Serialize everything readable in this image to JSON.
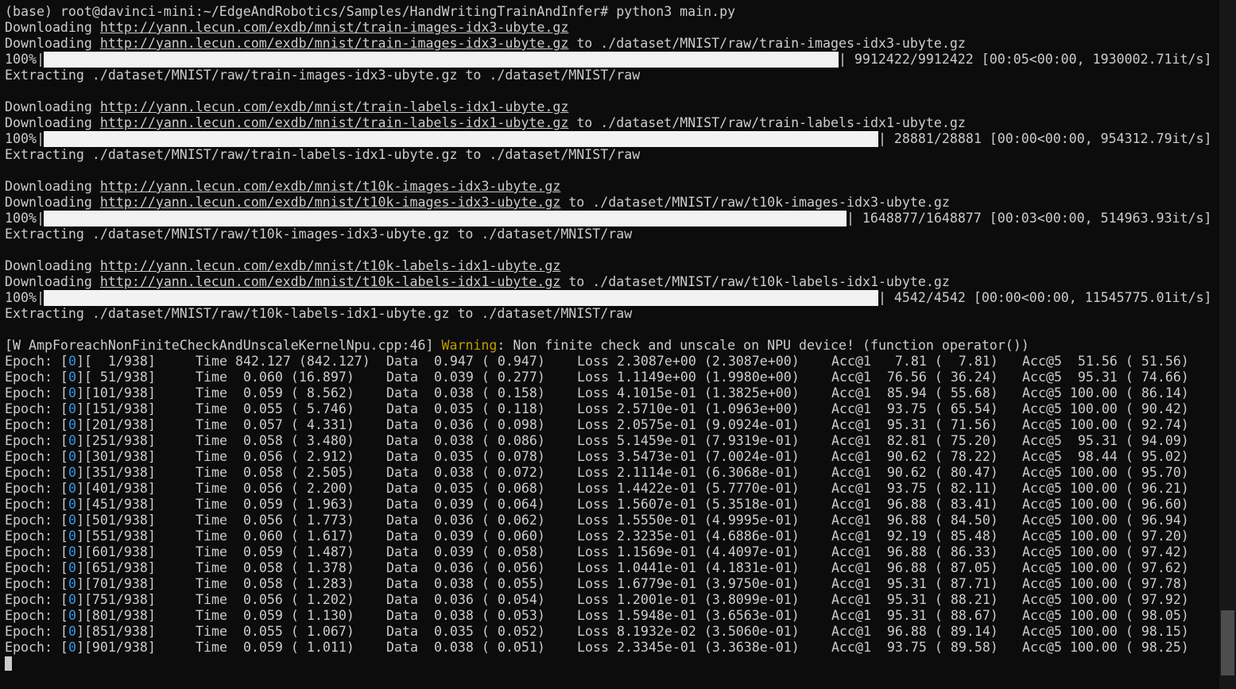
{
  "terminal": {
    "prompt": "(base) root@davinci-mini:~/EdgeAndRobotics/Samples/HandWritingTrainAndInfer# python3 main.py",
    "downloads": [
      {
        "url": "http://yann.lecun.com/exdb/mnist/train-images-idx3-ubyte.gz",
        "dest": "./dataset/MNIST/raw/train-images-idx3-ubyte.gz",
        "progress_pct": "100%|",
        "progress_fraction": 1.0,
        "progress_stats": "| 9912422/9912422 [00:05<00:00, 1930002.71it/s]",
        "extract": "Extracting ./dataset/MNIST/raw/train-images-idx3-ubyte.gz to ./dataset/MNIST/raw"
      },
      {
        "url": "http://yann.lecun.com/exdb/mnist/train-labels-idx1-ubyte.gz",
        "dest": "./dataset/MNIST/raw/train-labels-idx1-ubyte.gz",
        "progress_pct": "100%|",
        "progress_fraction": 1.0,
        "progress_stats": "| 28881/28881 [00:00<00:00, 954312.79it/s]",
        "extract": "Extracting ./dataset/MNIST/raw/train-labels-idx1-ubyte.gz to ./dataset/MNIST/raw"
      },
      {
        "url": "http://yann.lecun.com/exdb/mnist/t10k-images-idx3-ubyte.gz",
        "dest": "./dataset/MNIST/raw/t10k-images-idx3-ubyte.gz",
        "progress_pct": "100%|",
        "progress_fraction": 1.0,
        "progress_stats": "| 1648877/1648877 [00:03<00:00, 514963.93it/s]",
        "extract": "Extracting ./dataset/MNIST/raw/t10k-images-idx3-ubyte.gz to ./dataset/MNIST/raw"
      },
      {
        "url": "http://yann.lecun.com/exdb/mnist/t10k-labels-idx1-ubyte.gz",
        "dest": "./dataset/MNIST/raw/t10k-labels-idx1-ubyte.gz",
        "progress_pct": "100%|",
        "progress_fraction": 1.0,
        "progress_stats": "| 4542/4542 [00:00<00:00, 11545775.01it/s]",
        "extract": "Extracting ./dataset/MNIST/raw/t10k-labels-idx1-ubyte.gz to ./dataset/MNIST/raw"
      }
    ],
    "words": {
      "downloading": "Downloading ",
      "to": " to "
    },
    "warning": {
      "prefix": "[W AmpForeachNonFiniteCheckAndUnscaleKernelNpu.cpp:46] ",
      "label": "Warning",
      "message": ": Non finite check and unscale on NPU device! (function operator())"
    },
    "epoch_label": "Epoch: [",
    "epoch_index": "0",
    "epoch_rows": [
      {
        "step": "[  1/938]",
        "time": "Time 842.127 (842.127)",
        "data": "Data  0.947 ( 0.947)",
        "loss": "Loss 2.3087e+00 (2.3087e+00)",
        "acc1": "Acc@1   7.81 (  7.81)",
        "acc5": "Acc@5  51.56 ( 51.56)"
      },
      {
        "step": "[ 51/938]",
        "time": "Time  0.060 (16.897)",
        "data": "Data  0.039 ( 0.277)",
        "loss": "Loss 1.1149e+00 (1.9980e+00)",
        "acc1": "Acc@1  76.56 ( 36.24)",
        "acc5": "Acc@5  95.31 ( 74.66)"
      },
      {
        "step": "[101/938]",
        "time": "Time  0.059 ( 8.562)",
        "data": "Data  0.038 ( 0.158)",
        "loss": "Loss 4.1015e-01 (1.3825e+00)",
        "acc1": "Acc@1  85.94 ( 55.68)",
        "acc5": "Acc@5 100.00 ( 86.14)"
      },
      {
        "step": "[151/938]",
        "time": "Time  0.055 ( 5.746)",
        "data": "Data  0.035 ( 0.118)",
        "loss": "Loss 2.5710e-01 (1.0963e+00)",
        "acc1": "Acc@1  93.75 ( 65.54)",
        "acc5": "Acc@5 100.00 ( 90.42)"
      },
      {
        "step": "[201/938]",
        "time": "Time  0.057 ( 4.331)",
        "data": "Data  0.036 ( 0.098)",
        "loss": "Loss 2.0575e-01 (9.0924e-01)",
        "acc1": "Acc@1  95.31 ( 71.56)",
        "acc5": "Acc@5 100.00 ( 92.74)"
      },
      {
        "step": "[251/938]",
        "time": "Time  0.058 ( 3.480)",
        "data": "Data  0.038 ( 0.086)",
        "loss": "Loss 5.1459e-01 (7.9319e-01)",
        "acc1": "Acc@1  82.81 ( 75.20)",
        "acc5": "Acc@5  95.31 ( 94.09)"
      },
      {
        "step": "[301/938]",
        "time": "Time  0.056 ( 2.912)",
        "data": "Data  0.035 ( 0.078)",
        "loss": "Loss 3.5473e-01 (7.0024e-01)",
        "acc1": "Acc@1  90.62 ( 78.22)",
        "acc5": "Acc@5  98.44 ( 95.02)"
      },
      {
        "step": "[351/938]",
        "time": "Time  0.058 ( 2.505)",
        "data": "Data  0.038 ( 0.072)",
        "loss": "Loss 2.1114e-01 (6.3068e-01)",
        "acc1": "Acc@1  90.62 ( 80.47)",
        "acc5": "Acc@5 100.00 ( 95.70)"
      },
      {
        "step": "[401/938]",
        "time": "Time  0.056 ( 2.200)",
        "data": "Data  0.035 ( 0.068)",
        "loss": "Loss 1.4422e-01 (5.7770e-01)",
        "acc1": "Acc@1  93.75 ( 82.11)",
        "acc5": "Acc@5 100.00 ( 96.21)"
      },
      {
        "step": "[451/938]",
        "time": "Time  0.059 ( 1.963)",
        "data": "Data  0.039 ( 0.064)",
        "loss": "Loss 1.5607e-01 (5.3518e-01)",
        "acc1": "Acc@1  96.88 ( 83.41)",
        "acc5": "Acc@5 100.00 ( 96.60)"
      },
      {
        "step": "[501/938]",
        "time": "Time  0.056 ( 1.773)",
        "data": "Data  0.036 ( 0.062)",
        "loss": "Loss 1.5550e-01 (4.9995e-01)",
        "acc1": "Acc@1  96.88 ( 84.50)",
        "acc5": "Acc@5 100.00 ( 96.94)"
      },
      {
        "step": "[551/938]",
        "time": "Time  0.060 ( 1.617)",
        "data": "Data  0.039 ( 0.060)",
        "loss": "Loss 2.3235e-01 (4.6886e-01)",
        "acc1": "Acc@1  92.19 ( 85.48)",
        "acc5": "Acc@5 100.00 ( 97.20)"
      },
      {
        "step": "[601/938]",
        "time": "Time  0.059 ( 1.487)",
        "data": "Data  0.039 ( 0.058)",
        "loss": "Loss 1.1569e-01 (4.4097e-01)",
        "acc1": "Acc@1  96.88 ( 86.33)",
        "acc5": "Acc@5 100.00 ( 97.42)"
      },
      {
        "step": "[651/938]",
        "time": "Time  0.058 ( 1.378)",
        "data": "Data  0.036 ( 0.056)",
        "loss": "Loss 1.0441e-01 (4.1831e-01)",
        "acc1": "Acc@1  96.88 ( 87.05)",
        "acc5": "Acc@5 100.00 ( 97.62)"
      },
      {
        "step": "[701/938]",
        "time": "Time  0.058 ( 1.283)",
        "data": "Data  0.038 ( 0.055)",
        "loss": "Loss 1.6779e-01 (3.9750e-01)",
        "acc1": "Acc@1  95.31 ( 87.71)",
        "acc5": "Acc@5 100.00 ( 97.78)"
      },
      {
        "step": "[751/938]",
        "time": "Time  0.056 ( 1.202)",
        "data": "Data  0.036 ( 0.054)",
        "loss": "Loss 1.2001e-01 (3.8099e-01)",
        "acc1": "Acc@1  95.31 ( 88.21)",
        "acc5": "Acc@5 100.00 ( 97.92)"
      },
      {
        "step": "[801/938]",
        "time": "Time  0.059 ( 1.130)",
        "data": "Data  0.038 ( 0.053)",
        "loss": "Loss 1.5948e-01 (3.6563e-01)",
        "acc1": "Acc@1  95.31 ( 88.67)",
        "acc5": "Acc@5 100.00 ( 98.05)"
      },
      {
        "step": "[851/938]",
        "time": "Time  0.055 ( 1.067)",
        "data": "Data  0.035 ( 0.052)",
        "loss": "Loss 8.1932e-02 (3.5060e-01)",
        "acc1": "Acc@1  96.88 ( 89.14)",
        "acc5": "Acc@5 100.00 ( 98.15)"
      },
      {
        "step": "[901/938]",
        "time": "Time  0.059 ( 1.011)",
        "data": "Data  0.038 ( 0.051)",
        "loss": "Loss 2.3345e-01 (3.3638e-01)",
        "acc1": "Acc@1  93.75 ( 89.58)",
        "acc5": "Acc@5 100.00 ( 98.25)"
      }
    ]
  },
  "colors": {
    "background": "#0c0c0c",
    "foreground": "#cccccc",
    "epoch_index": "#3a96dd",
    "warning": "#c19c00",
    "progress_bar": "#f2f2f2"
  }
}
